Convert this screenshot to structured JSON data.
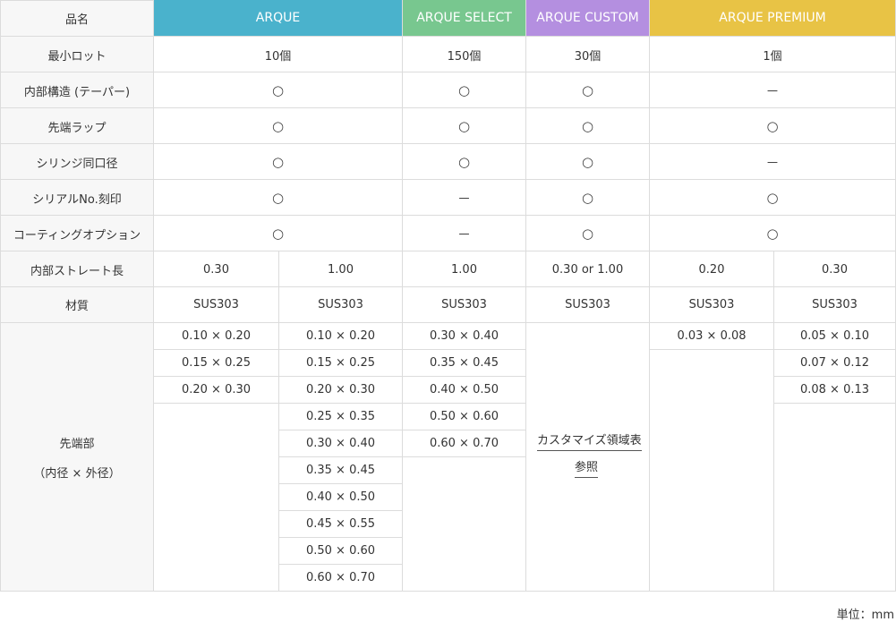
{
  "header": {
    "label": "品名",
    "products": [
      {
        "name": "ARQUE",
        "color": "#4ab2cc"
      },
      {
        "name": "ARQUE SELECT",
        "color": "#78c78f"
      },
      {
        "name": "ARQUE CUSTOM",
        "color": "#b48fe0"
      },
      {
        "name": "ARQUE PREMIUM",
        "color": "#e8c345"
      }
    ]
  },
  "rows": {
    "min_lot": {
      "label": "最小ロット",
      "values": [
        "10個",
        "150個",
        "30個",
        "1個"
      ]
    },
    "taper": {
      "label": "内部構造 (テーパー)",
      "values": [
        "○",
        "○",
        "○",
        "－"
      ]
    },
    "tip_lap": {
      "label": "先端ラップ",
      "values": [
        "○",
        "○",
        "○",
        "○"
      ]
    },
    "syringe": {
      "label": "シリンジ同口径",
      "values": [
        "○",
        "○",
        "○",
        "－"
      ]
    },
    "serial": {
      "label": "シリアルNo.刻印",
      "values": [
        "○",
        "－",
        "○",
        "○"
      ]
    },
    "coating": {
      "label": "コーティングオプション",
      "values": [
        "○",
        "－",
        "○",
        "○"
      ]
    },
    "straight": {
      "label": "内部ストレート長",
      "values": [
        "0.30",
        "1.00",
        "1.00",
        "0.30 or 1.00",
        "0.20",
        "0.30"
      ]
    },
    "material": {
      "label": "材質",
      "values": [
        "SUS303",
        "SUS303",
        "SUS303",
        "SUS303",
        "SUS303",
        "SUS303"
      ]
    }
  },
  "tip": {
    "label_line1": "先端部",
    "label_line2": "（内径 × 外径）",
    "arque_a": [
      "0.10 × 0.20",
      "0.15 × 0.25",
      "0.20 × 0.30"
    ],
    "arque_b": [
      "0.10 × 0.20",
      "0.15 × 0.25",
      "0.20 × 0.30",
      "0.25 × 0.35",
      "0.30 × 0.40",
      "0.35 × 0.45",
      "0.40 × 0.50",
      "0.45 × 0.55",
      "0.50 × 0.60",
      "0.60 × 0.70"
    ],
    "select": [
      "0.30 × 0.40",
      "0.35 × 0.45",
      "0.40 × 0.50",
      "0.50 × 0.60",
      "0.60 × 0.70"
    ],
    "custom_ref_line1": "カスタマイズ領域表",
    "custom_ref_line2": "参照",
    "premium_a": [
      "0.03 × 0.08"
    ],
    "premium_b": [
      "0.05 × 0.10",
      "0.07 × 0.12",
      "0.08 × 0.13"
    ]
  },
  "unit": "単位：mm"
}
